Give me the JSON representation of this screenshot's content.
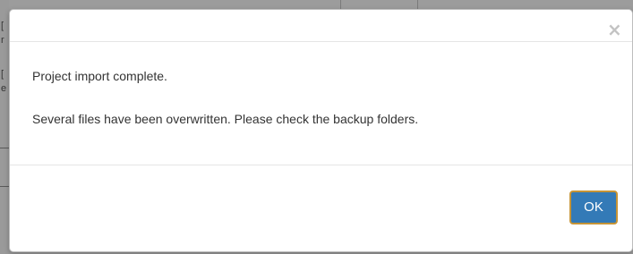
{
  "background": {
    "fragments": [
      "[",
      "r",
      "[",
      "e"
    ]
  },
  "modal": {
    "close_symbol": "×",
    "messages": [
      "Project import complete.",
      "Several files have been overwritten. Please check the backup folders."
    ],
    "ok_label": "OK"
  },
  "colors": {
    "ok_button_bg": "#337ab7",
    "ok_button_border": "#c69436",
    "text": "#333333",
    "close": "#c3c3c3",
    "overlay": "#9a9a9a"
  }
}
